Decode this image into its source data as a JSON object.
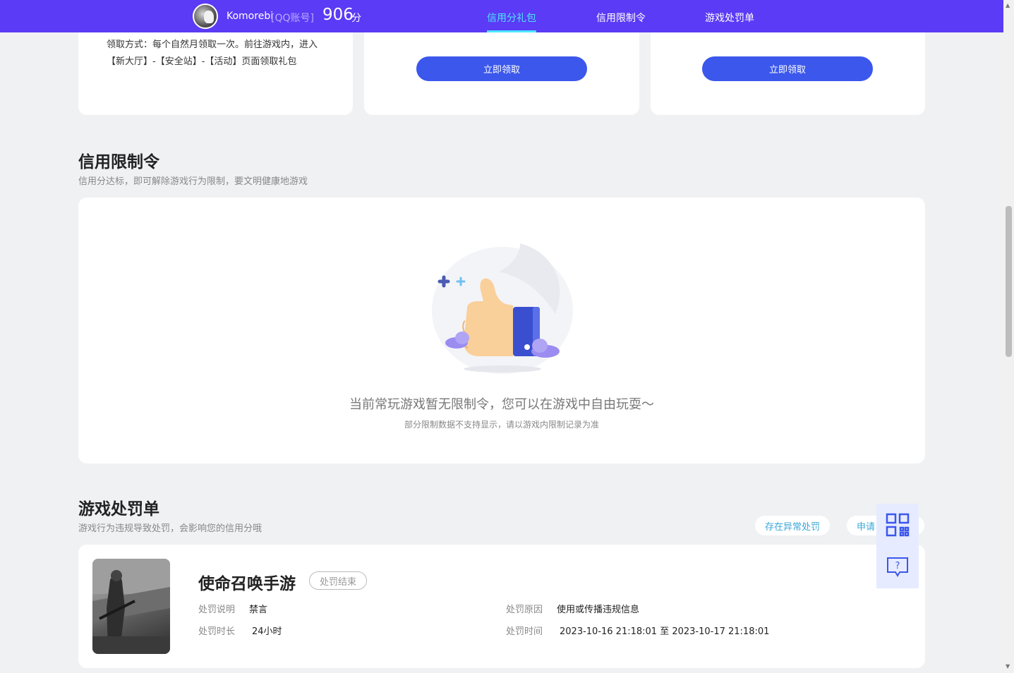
{
  "header": {
    "user_name": "Komorebi",
    "account_type": "[QQ账号]",
    "score": "906",
    "score_unit": "分",
    "tabs": [
      {
        "label": "信用分礼包",
        "active": true
      },
      {
        "label": "信用限制令",
        "active": false
      },
      {
        "label": "游戏处罚单",
        "active": false
      }
    ]
  },
  "gift": {
    "desc": "领取方式：每个自然月领取一次。前往游戏内，进入【新大厅】-【安全站】-【活动】页面领取礼包",
    "claim_label": "立即领取"
  },
  "restriction": {
    "title": "信用限制令",
    "subtitle": "信用分达标，即可解除游戏行为限制，要文明健康地游戏",
    "empty_main": "当前常玩游戏暂无限制令，您可以在游戏中自由玩耍～",
    "empty_sub": "部分限制数据不支持显示，请以游戏内限制记录为准"
  },
  "penalty": {
    "title": "游戏处罚单",
    "subtitle": "游戏行为违规导致处罚，会影响您的信用分哦",
    "abnormal_label": "存在异常处罚",
    "appeal_label": "申请",
    "record": {
      "game_name": "使命召唤手游",
      "status": "处罚结束",
      "desc_label": "处罚说明",
      "desc_value": "禁言",
      "duration_label": "处罚时长",
      "duration_value": "24小时",
      "reason_label": "处罚原因",
      "reason_value": "使用或传播违规信息",
      "time_label": "处罚时间",
      "time_value": "2023-10-16 21:18:01 至 2023-10-17 21:18:01"
    }
  },
  "icons": {
    "qr": "qr-code-icon",
    "help": "help-chat-icon"
  },
  "colors": {
    "header_bg": "#5b3bf5",
    "active_tab": "#4ee4ff",
    "button_bg": "#3b57ec"
  }
}
